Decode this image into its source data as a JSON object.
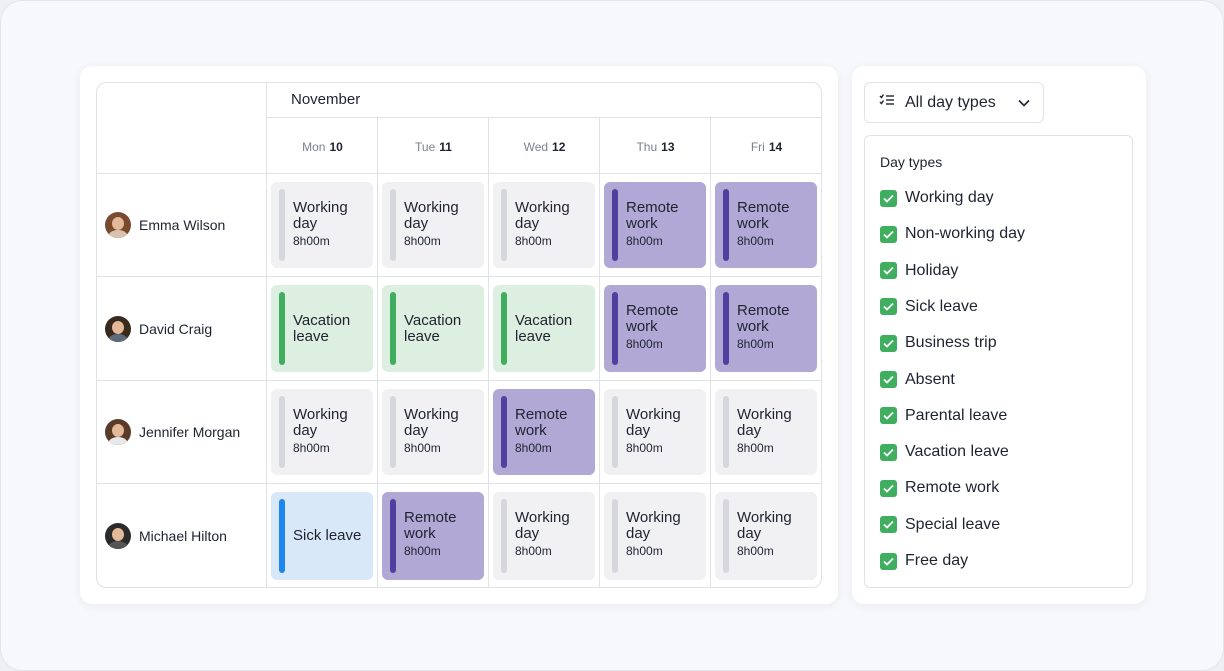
{
  "calendar": {
    "month": "November",
    "days": [
      {
        "dow": "Mon",
        "num": "10"
      },
      {
        "dow": "Tue",
        "num": "11"
      },
      {
        "dow": "Wed",
        "num": "12"
      },
      {
        "dow": "Thu",
        "num": "13"
      },
      {
        "dow": "Fri",
        "num": "14"
      }
    ],
    "people": [
      {
        "name": "Emma Wilson",
        "cells": [
          {
            "type": "Working day",
            "hours": "8h00m",
            "kind": "working"
          },
          {
            "type": "Working day",
            "hours": "8h00m",
            "kind": "working"
          },
          {
            "type": "Working day",
            "hours": "8h00m",
            "kind": "working"
          },
          {
            "type": "Remote work",
            "hours": "8h00m",
            "kind": "remote"
          },
          {
            "type": "Remote work",
            "hours": "8h00m",
            "kind": "remote"
          }
        ]
      },
      {
        "name": "David Craig",
        "cells": [
          {
            "type": "Vacation leave",
            "hours": "",
            "kind": "vacation"
          },
          {
            "type": "Vacation leave",
            "hours": "",
            "kind": "vacation"
          },
          {
            "type": "Vacation leave",
            "hours": "",
            "kind": "vacation"
          },
          {
            "type": "Remote work",
            "hours": "8h00m",
            "kind": "remote"
          },
          {
            "type": "Remote work",
            "hours": "8h00m",
            "kind": "remote"
          }
        ]
      },
      {
        "name": "Jennifer Morgan",
        "cells": [
          {
            "type": "Working day",
            "hours": "8h00m",
            "kind": "working"
          },
          {
            "type": "Working day",
            "hours": "8h00m",
            "kind": "working"
          },
          {
            "type": "Remote work",
            "hours": "8h00m",
            "kind": "remote"
          },
          {
            "type": "Working day",
            "hours": "8h00m",
            "kind": "working"
          },
          {
            "type": "Working day",
            "hours": "8h00m",
            "kind": "working"
          }
        ]
      },
      {
        "name": "Michael Hilton",
        "cells": [
          {
            "type": "Sick leave",
            "hours": "",
            "kind": "sick"
          },
          {
            "type": "Remote work",
            "hours": "8h00m",
            "kind": "remote"
          },
          {
            "type": "Working day",
            "hours": "8h00m",
            "kind": "working"
          },
          {
            "type": "Working day",
            "hours": "8h00m",
            "kind": "working"
          },
          {
            "type": "Working day",
            "hours": "8h00m",
            "kind": "working"
          }
        ]
      }
    ]
  },
  "filter": {
    "dropdown_label": "All day types",
    "dropdown_icon": "filter-list-icon",
    "panel_title": "Day types",
    "types": [
      {
        "label": "Working day",
        "checked": true
      },
      {
        "label": "Non-working day",
        "checked": true
      },
      {
        "label": "Holiday",
        "checked": true
      },
      {
        "label": "Sick leave",
        "checked": true
      },
      {
        "label": "Business trip",
        "checked": true
      },
      {
        "label": "Absent",
        "checked": true
      },
      {
        "label": "Parental leave",
        "checked": true
      },
      {
        "label": "Vacation leave",
        "checked": true
      },
      {
        "label": "Remote work",
        "checked": true
      },
      {
        "label": "Special leave",
        "checked": true
      },
      {
        "label": "Free day",
        "checked": true
      }
    ]
  },
  "colors": {
    "working_bg": "#f1f1f3",
    "remote_bg": "#b1a8d6",
    "remote_bar": "#4f3f9e",
    "vacation_bg": "#dcefe1",
    "vacation_bar": "#3fae5f",
    "sick_bg": "#d9e8f8",
    "sick_bar": "#1f86f0",
    "checkbox": "#3fae5f"
  }
}
